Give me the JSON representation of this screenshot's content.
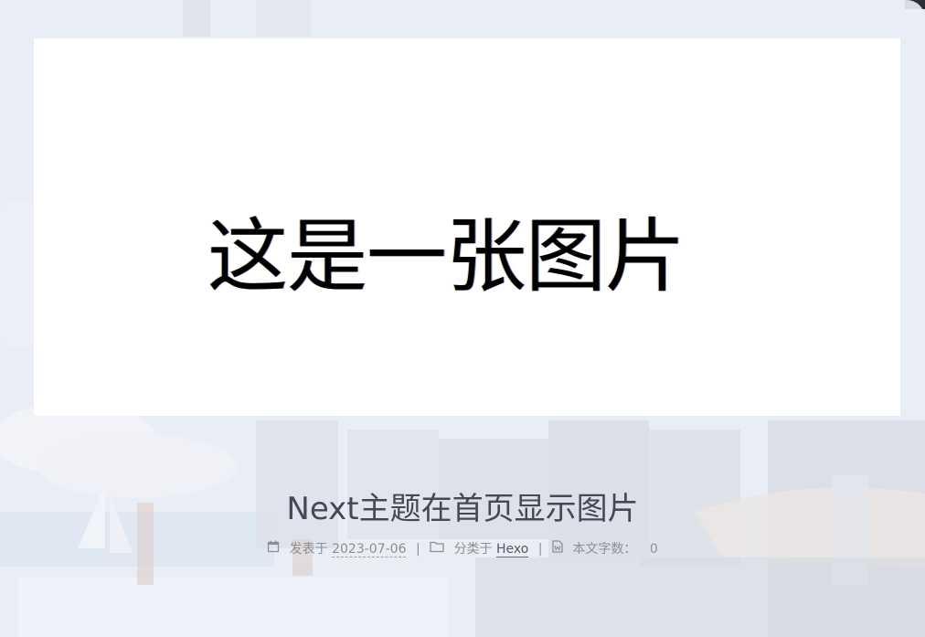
{
  "featured_image": {
    "text": "这是一张图片"
  },
  "post": {
    "title": "Next主题在首页显示图片",
    "meta": {
      "posted_label": "发表于",
      "date": "2023-07-06",
      "category_label": "分类于",
      "category": "Hexo",
      "wordcount_label": "本文字数：",
      "wordcount": "0",
      "separator": "|"
    }
  },
  "icons": {
    "date": "calendar-icon",
    "category": "folder-icon",
    "wordcount": "file-word-icon"
  },
  "colors": {
    "title": "#444a55",
    "meta_text": "#8a8f99",
    "link": "#555b66",
    "image_bg": "#ffffff"
  }
}
